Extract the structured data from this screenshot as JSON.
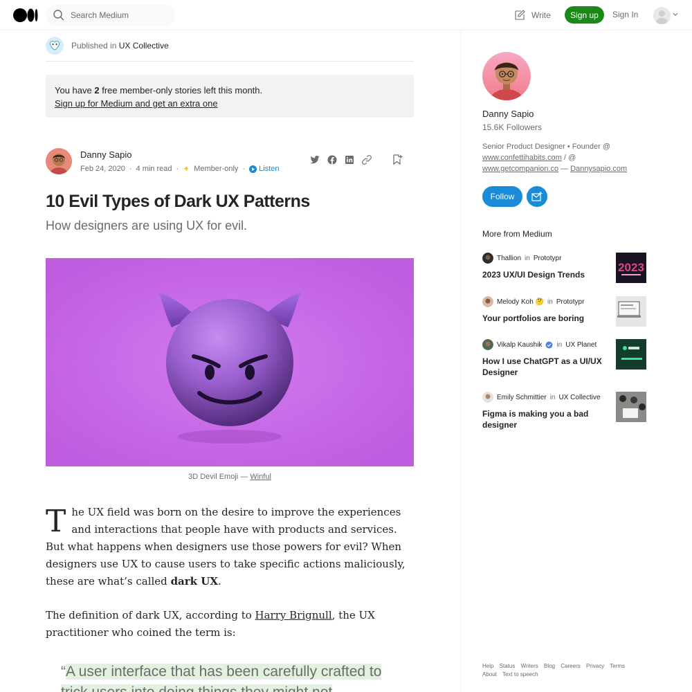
{
  "topbar": {
    "search_placeholder": "Search Medium",
    "write_label": "Write",
    "signup_label": "Sign up",
    "signin_label": "Sign In"
  },
  "publication": {
    "published_in": "Published in",
    "name": "UX Collective"
  },
  "member_box": {
    "prefix": "You have ",
    "count": "2",
    "suffix": " free member-only stories left this month.",
    "link": "Sign up for Medium and get an extra one"
  },
  "byline": {
    "author": "Danny Sapio",
    "date": "Feb 24, 2020",
    "read_time": "4 min read",
    "member_only": "Member-only",
    "listen": "Listen"
  },
  "article": {
    "title": "10 Evil Types of Dark UX Patterns",
    "subtitle": "How designers are using UX for evil.",
    "caption_text": "3D Devil Emoji — ",
    "caption_link": "Winful",
    "p1_dropcap": "T",
    "p1_text": "he UX field was born on the desire to improve the experiences and interactions that people have with products and services. But what happens when designers use those powers for evil? When designers use UX to cause users to take specific actions maliciously, these are what’s called ",
    "p1_bold": "dark UX",
    "p1_end": ".",
    "p2_before": "The definition of dark UX, according to ",
    "p2_link": "Harry Brignull",
    "p2_after": ", the UX practitioner who coined the term is:",
    "quote_open": "“",
    "quote_text": "A user interface that has been carefully crafted to trick users into doing things they might not otherwise do"
  },
  "sidebar": {
    "name": "Danny Sapio",
    "followers": "15.6K Followers",
    "bio_text": "Senior Product Designer • Founder @ ",
    "bio_link1": "www.confettihabits.com",
    "bio_mid": " / @ ",
    "bio_link2": "www.getcompanion.co",
    "bio_dash": " — ",
    "bio_link3": "Dannysapio.com",
    "follow_label": "Follow",
    "more_heading": "More from Medium",
    "recs": [
      {
        "author": "Thallion",
        "in": "in",
        "publication": "Prototypr",
        "title": "2023 UX/UI Design Trends"
      },
      {
        "author": "Melody Koh 🤔",
        "in": "in",
        "publication": "Prototypr",
        "title": "Your portfolios are boring"
      },
      {
        "author": "Vikalp Kaushik",
        "in": "in",
        "publication": "UX Planet",
        "title": "How I use ChatGPT as a UI/UX Designer"
      },
      {
        "author": "Emily Schmittier",
        "in": "in",
        "publication": "UX Collective",
        "title": "Figma is making you a bad designer"
      }
    ],
    "footer": [
      "Help",
      "Status",
      "Writers",
      "Blog",
      "Careers",
      "Privacy",
      "Terms",
      "About",
      "Text to speech"
    ]
  },
  "colors": {
    "brand_green": "#1a8917",
    "accent_blue": "#1a8bd6",
    "hero_purple": "#bf5ee0"
  }
}
